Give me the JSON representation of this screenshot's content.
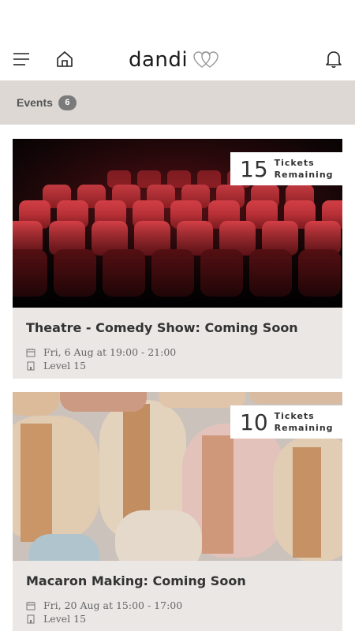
{
  "header": {
    "logo_text": "dandi",
    "icons": [
      "menu-icon",
      "home-icon",
      "heart-logo-icon",
      "bell-icon"
    ]
  },
  "events_bar": {
    "label": "Events",
    "count": "6"
  },
  "events": [
    {
      "title": "Theatre - Comedy Show: Coming Soon",
      "date": "Fri, 6 Aug at 19:00 - 21:00",
      "location": "Level 15",
      "tickets_count": "15",
      "tickets_label_1": "Tickets",
      "tickets_label_2": "Remaining"
    },
    {
      "title": "Macaron Making: Coming Soon",
      "date": "Fri, 20 Aug at 15:00 - 17:00",
      "location": "Level 15",
      "tickets_count": "10",
      "tickets_label_1": "Tickets",
      "tickets_label_2": "Remaining"
    }
  ],
  "colors": {
    "events_bar_bg": "#ddd8d4",
    "card_bg": "#eae7e5",
    "badge_count_bg": "#7a7a7a",
    "theatre_seat_red": "#b0262c"
  }
}
